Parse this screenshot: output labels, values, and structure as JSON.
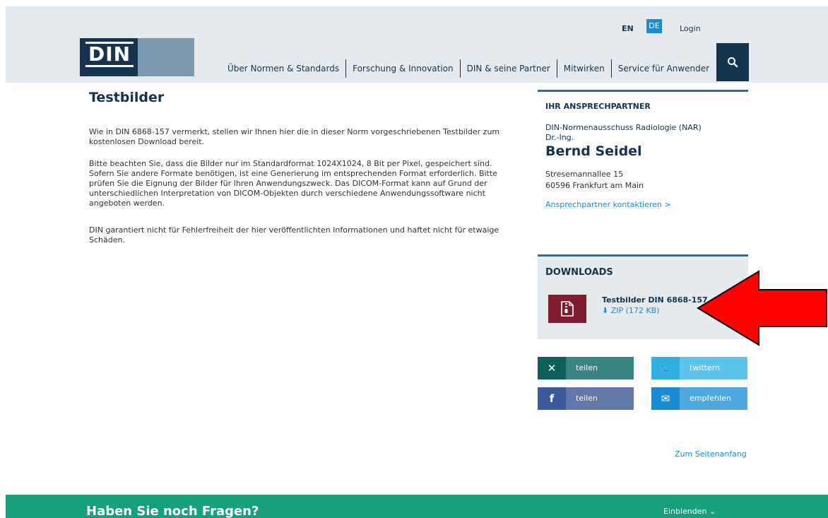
{
  "header": {
    "lang_en": "EN",
    "lang_de": "DE",
    "login": "Login",
    "logo_text": "DIN",
    "nav": [
      "Über Normen & Standards",
      "Forschung & Innovation",
      "DIN & seine Partner",
      "Mitwirken",
      "Service für Anwender"
    ],
    "search_icon": "search-icon"
  },
  "main": {
    "title": "Testbilder",
    "paragraphs": [
      "Wie in DIN 6868-157 vermerkt, stellen wir Ihnen hier die in dieser Norm vorgeschriebenen Testbilder zum kostenlosen Download bereit.",
      "Bitte beachten Sie, dass die Bilder nur im Standardformat 1024X1024, 8 Bit per Pixel, gespeichert sind. Sofern Sie andere Formate benötigen, ist eine Generierung im entsprechenden Format erforderlich. Bitte prüfen Sie die Eignung der Bilder für Ihren Anwendungszweck. Das DICOM-Format kann auf Grund der unterschiedlichen Interpretation von DICOM-Objekten durch verschiedene Anwendungssoftware nicht angeboten werden.",
      "DIN garantiert nicht für Fehlerfreiheit der hier veröffentlichten Informationen und haftet nicht für etwaige Schäden."
    ]
  },
  "contact": {
    "heading": "IHR ANSPRECHPARTNER",
    "org": "DIN-Normenausschuss Radiologie (NAR)",
    "title": "Dr.-Ing.",
    "name": "Bernd Seidel",
    "address_line1": "Stresemannallee 15",
    "address_line2": "60596 Frankfurt am Main",
    "link": "Ansprechpartner kontaktieren >"
  },
  "downloads": {
    "heading": "DOWNLOADS",
    "file_title": "Testbilder DIN 6868-157",
    "file_link": "ZIP (172 KB)"
  },
  "social": {
    "xing": "teilen",
    "twitter": "twittern",
    "facebook": "teilen",
    "mail": "empfehlen"
  },
  "top_link": "Zum Seitenanfang",
  "footer": {
    "title": "Haben Sie noch Fragen?",
    "toggle": "Einblenden"
  },
  "colors": {
    "brand_dark": "#14344e",
    "accent_blue": "#1a8cd1",
    "footer_green": "#17a07c",
    "zip_red": "#7f1d2e",
    "arrow_red": "#ff0000"
  }
}
